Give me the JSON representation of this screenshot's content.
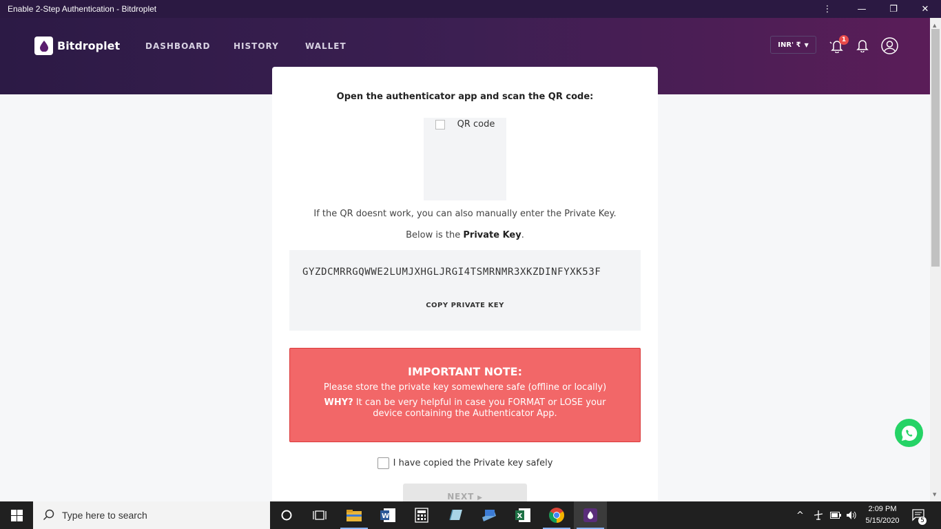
{
  "window": {
    "title": "Enable 2-Step Authentication - Bitdroplet",
    "controls": [
      "more-options",
      "minimize",
      "restore",
      "close"
    ]
  },
  "header": {
    "brand": "Bitdroplet",
    "nav": [
      "DASHBOARD",
      "HISTORY",
      "WALLET"
    ],
    "currency": "INR' ₹",
    "notification_count": "1"
  },
  "setup": {
    "scan_title": "Open the authenticator app and scan the QR code:",
    "qr_alt": "QR code",
    "manual_line": "If the QR doesnt work, you can also manually enter the Private Key.",
    "below_prefix": "Below is the ",
    "below_bold": "Private Key",
    "below_suffix": ".",
    "private_key": "GYZDCMRRGQWWE2LUMJXHGLJRGI4TSMRNMR3XKZDINFYXK53F",
    "copy_label": "COPY PRIVATE KEY"
  },
  "note": {
    "title": "IMPORTANT NOTE:",
    "line1": "Please store the private key somewhere safe (offline or locally)",
    "why": "WHY?",
    "line2": " It can be very helpful in case you FORMAT or LOSE your device containing the Authenticator App."
  },
  "confirm": {
    "checkbox_label": "I have copied the Private key safely",
    "checked": false,
    "next_label": "NEXT"
  },
  "taskbar": {
    "search_placeholder": "Type here to search",
    "time": "2:09 PM",
    "date": "5/15/2020",
    "notification_count": "5"
  },
  "colors": {
    "header_start": "#2c1a45",
    "header_end": "#5a1d58",
    "note_bg": "#f26768",
    "whatsapp": "#25d366"
  }
}
